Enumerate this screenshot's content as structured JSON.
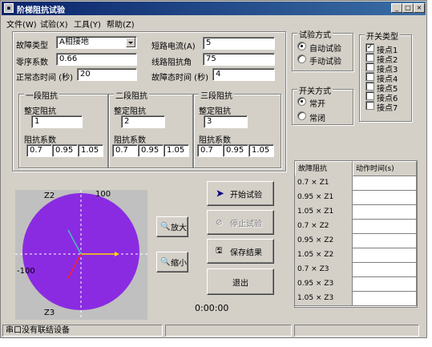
{
  "window": {
    "title": "阶梯阻抗试验",
    "title_icon": "app-icon",
    "min": "_",
    "max": "□",
    "close": "×"
  },
  "menu": [
    "文件(W)",
    "试验(X)",
    "工具(Y)",
    "帮助(Z)"
  ],
  "params": {
    "fault_type_label": "故障类型",
    "fault_type_value": "A相接地",
    "zero_seq_label": "零序系数",
    "zero_seq_value": "0.66",
    "normal_time_label": "正常态时间 (秒)",
    "normal_time_value": "20",
    "short_current_label": "短路电流(A)",
    "short_current_value": "5",
    "line_angle_label": "线路阻抗角",
    "line_angle_value": "75",
    "fault_time_label": "故障态时间 (秒)",
    "fault_time_value": "4"
  },
  "zones": [
    {
      "title": "一段阻抗",
      "setting_label": "整定阻抗",
      "setting_value": "1",
      "coef_label": "阻抗系数",
      "coefs": [
        "0.7",
        "0.95",
        "1.05"
      ]
    },
    {
      "title": "二段阻抗",
      "setting_label": "整定阻抗",
      "setting_value": "2",
      "coef_label": "阻抗系数",
      "coefs": [
        "0.7",
        "0.95",
        "1.05"
      ]
    },
    {
      "title": "三段阻抗",
      "setting_label": "整定阻抗",
      "setting_value": "3",
      "coef_label": "阻抗系数",
      "coefs": [
        "0.7",
        "0.95",
        "1.05"
      ]
    }
  ],
  "test_mode": {
    "title": "试验方式",
    "options": [
      "自动试验",
      "手动试验"
    ],
    "selected": 0
  },
  "switch_mode": {
    "title": "开关方式",
    "options": [
      "常开",
      "常闭"
    ],
    "selected": 0
  },
  "switch_type": {
    "title": "开关类型",
    "items": [
      "接点1",
      "接点2",
      "接点3",
      "接点4",
      "接点5",
      "接点6",
      "接点7"
    ],
    "checked": [
      true,
      false,
      false,
      false,
      false,
      false,
      false
    ]
  },
  "plot": {
    "top_label": "100",
    "left_label": "-100",
    "z2_label": "Z2",
    "z3_label": "Z3",
    "circle_color": "#8a2be2",
    "bg_color": "#c0c0c0"
  },
  "zoom": {
    "in_label": "放大",
    "out_label": "缩小"
  },
  "actions": {
    "start": "开始试验",
    "stop": "停止试验",
    "save": "保存结果",
    "exit": "退出"
  },
  "timer": "0:00:00",
  "results": {
    "headers": [
      "故障阻抗",
      "动作时间(s)"
    ],
    "rows": [
      "0.7 × Z1",
      "0.95 × Z1",
      "1.05 × Z1",
      "0.7 × Z2",
      "0.95 × Z2",
      "1.05 × Z2",
      "0.7 × Z3",
      "0.95 × Z3",
      "1.05 × Z3"
    ]
  },
  "status": {
    "message": "串口没有联结设备"
  }
}
